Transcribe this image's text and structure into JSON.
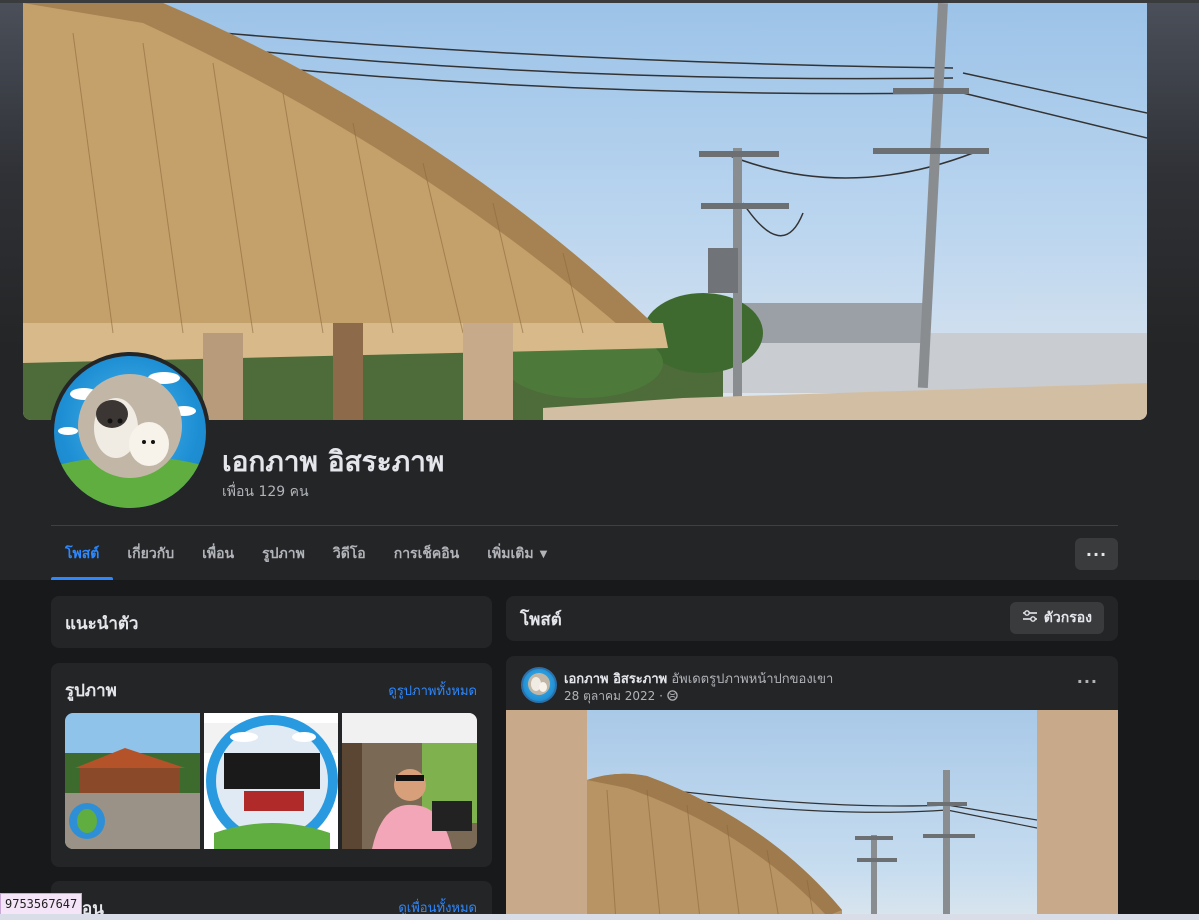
{
  "profile": {
    "name": "เอกภาพ อิสระภาพ",
    "friends_count": "เพื่อน 129 คน"
  },
  "tabs": [
    {
      "label": "โพสต์",
      "active": true
    },
    {
      "label": "เกี่ยวกับ",
      "active": false
    },
    {
      "label": "เพื่อน",
      "active": false
    },
    {
      "label": "รูปภาพ",
      "active": false
    },
    {
      "label": "วิดีโอ",
      "active": false
    },
    {
      "label": "การเช็คอิน",
      "active": false
    },
    {
      "label": "เพิ่มเติม",
      "active": false
    }
  ],
  "more_button": "···",
  "intro": {
    "title": "แนะนำตัว"
  },
  "photos": {
    "title": "รูปภาพ",
    "see_all": "ดูรูปภาพทั้งหมด"
  },
  "friends": {
    "title": "เพื่อน",
    "see_all": "ดูเพื่อนทั้งหมด"
  },
  "posts": {
    "title": "โพสต์",
    "filter_label": "ตัวกรอง"
  },
  "post": {
    "author": "เอกภาพ อิสระภาพ",
    "action": "อัพเดตรูปภาพหน้าปกของเขา",
    "date": "28 ตุลาคม 2022 ·",
    "menu": "···"
  },
  "id_badge": "9753567647",
  "colors": {
    "accent": "#2d88ff",
    "bg": "#18191a",
    "card": "#242526"
  }
}
